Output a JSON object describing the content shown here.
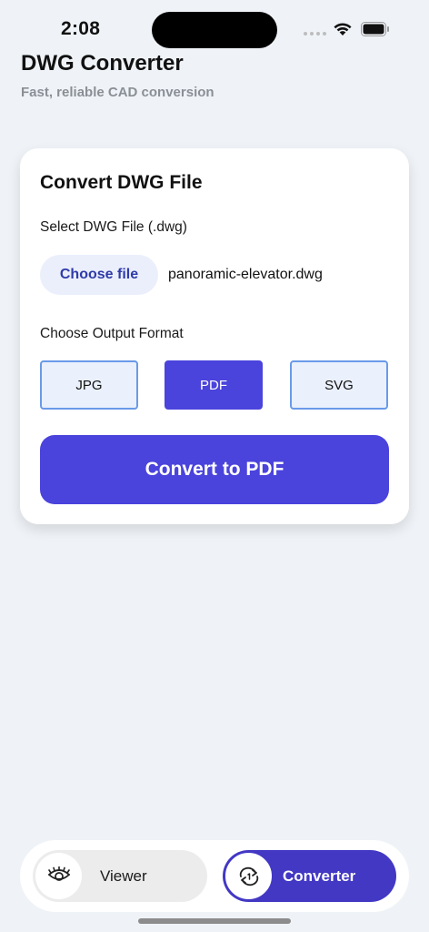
{
  "status_bar": {
    "time": "2:08"
  },
  "header": {
    "title": "DWG Converter",
    "subtitle": "Fast, reliable CAD conversion"
  },
  "card": {
    "title": "Convert DWG File",
    "file_label": "Select DWG File (.dwg)",
    "choose_file_label": "Choose file",
    "file_name": "panoramic-elevator.dwg",
    "format_label": "Choose Output Format",
    "formats": [
      {
        "label": "JPG",
        "selected": false
      },
      {
        "label": "PDF",
        "selected": true
      },
      {
        "label": "SVG",
        "selected": false
      }
    ],
    "convert_label": "Convert to PDF"
  },
  "tabs": [
    {
      "label": "Viewer",
      "icon": "eye-icon",
      "active": false
    },
    {
      "label": "Converter",
      "icon": "convert-cycle-icon",
      "active": true
    }
  ],
  "colors": {
    "accent": "#4a43dc",
    "active_tab": "#4238c4",
    "background": "#eff3f7",
    "subtitle": "#8a8f96"
  }
}
